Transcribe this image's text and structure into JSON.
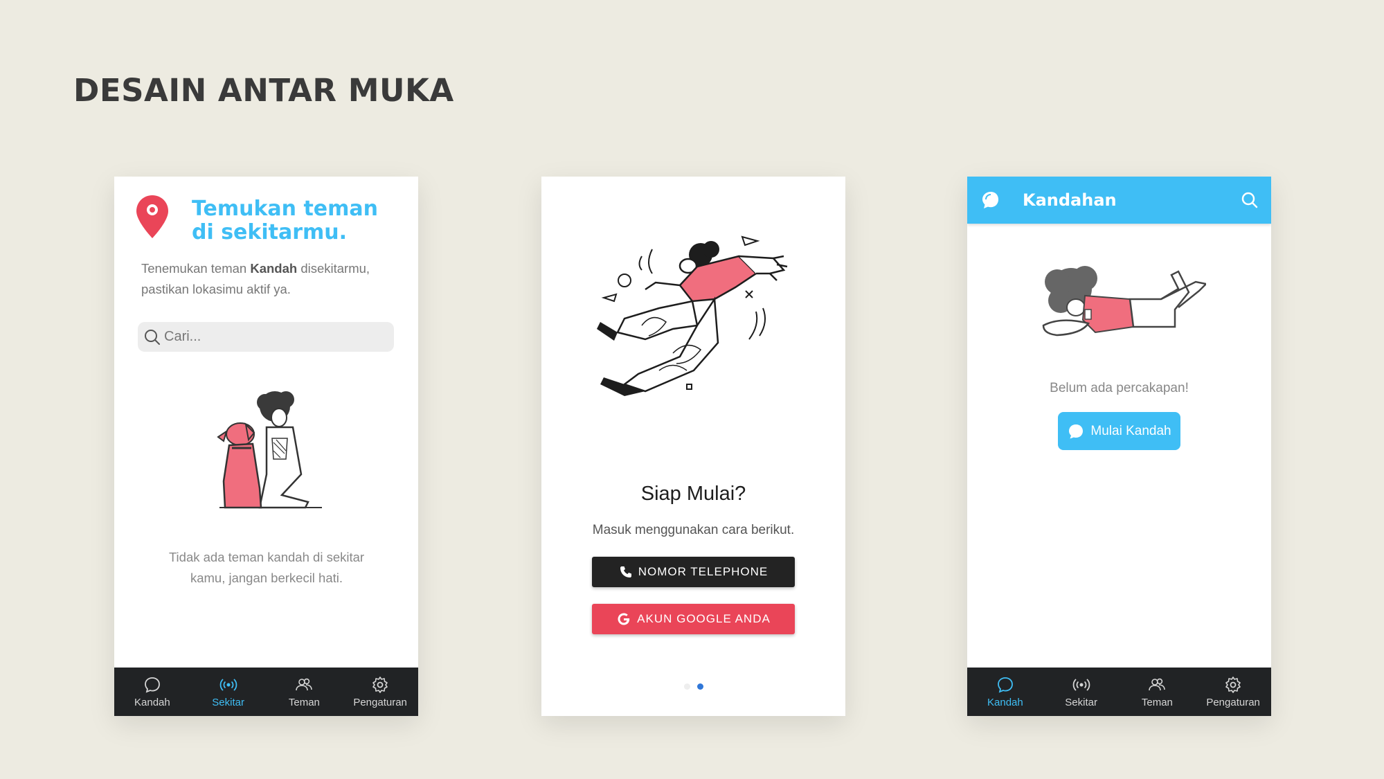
{
  "page": {
    "title": "DESAIN ANTAR MUKA"
  },
  "colors": {
    "accent": "#3fbef5",
    "red": "#ea4558",
    "dark": "#212325",
    "background": "#edebe1"
  },
  "screen1": {
    "heading_line1": "Temukan teman",
    "heading_line2": "di sekitarmu.",
    "desc_before": "Tenemukan teman ",
    "desc_bold": "Kandah",
    "desc_after": " disekitarmu,",
    "desc_line2": "pastikan lokasimu aktif ya.",
    "search_placeholder": "Cari...",
    "empty_line1": "Tidak ada teman kandah di sekitar",
    "empty_line2": "kamu, jangan berkecil hati."
  },
  "screen2": {
    "title": "Siap Mulai?",
    "subtitle": "Masuk menggunakan cara berikut.",
    "phone_button": "NOMOR TELEPHONE",
    "google_button": "AKUN GOOGLE ANDA"
  },
  "screen3": {
    "app_title": "Kandahan",
    "empty_text": "Belum ada percakapan!",
    "start_button": "Mulai Kandah"
  },
  "nav": {
    "items": [
      {
        "label": "Kandah",
        "icon": "chat-bubble-icon"
      },
      {
        "label": "Sekitar",
        "icon": "broadcast-icon"
      },
      {
        "label": "Teman",
        "icon": "friends-icon"
      },
      {
        "label": "Pengaturan",
        "icon": "gear-icon"
      }
    ]
  }
}
